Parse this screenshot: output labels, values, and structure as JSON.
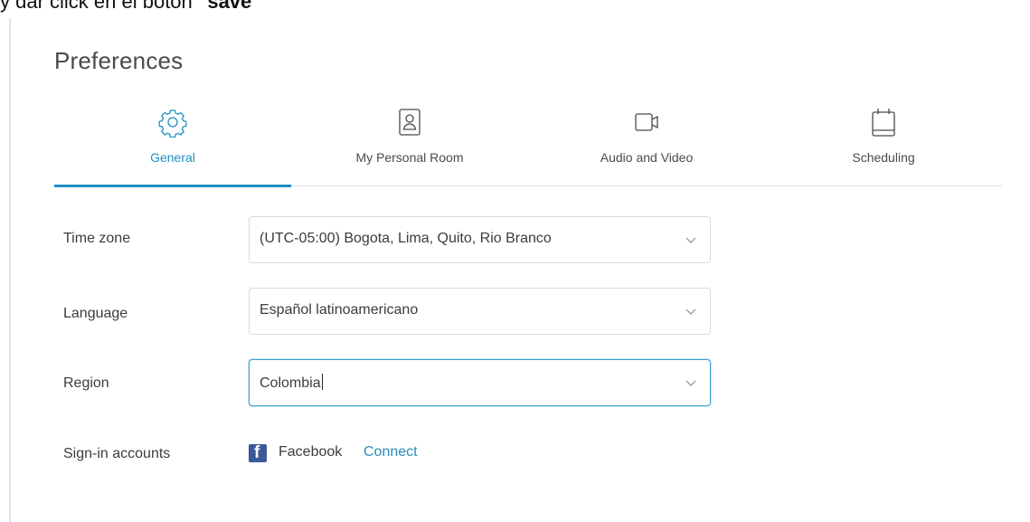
{
  "instruction": {
    "prefix": "y dar click en el botón",
    "bold": "\"save\""
  },
  "page": {
    "title": "Preferences"
  },
  "tabs": [
    {
      "label": "General",
      "icon": "gear-icon",
      "active": true
    },
    {
      "label": "My Personal Room",
      "icon": "person-card-icon",
      "active": false
    },
    {
      "label": "Audio and Video",
      "icon": "video-camera-icon",
      "active": false
    },
    {
      "label": "Scheduling",
      "icon": "calendar-icon",
      "active": false
    }
  ],
  "form": {
    "time_zone": {
      "label": "Time zone",
      "value": "(UTC-05:00) Bogota, Lima, Quito, Rio Branco"
    },
    "language": {
      "label": "Language",
      "value": "Español latinoamericano"
    },
    "region": {
      "label": "Region",
      "value": "Colombia"
    },
    "signin": {
      "label": "Sign-in accounts",
      "provider": "Facebook",
      "action": "Connect"
    }
  },
  "colors": {
    "accent": "#1f8fc4",
    "facebook": "#3b5998",
    "link": "#2a8ab8"
  }
}
